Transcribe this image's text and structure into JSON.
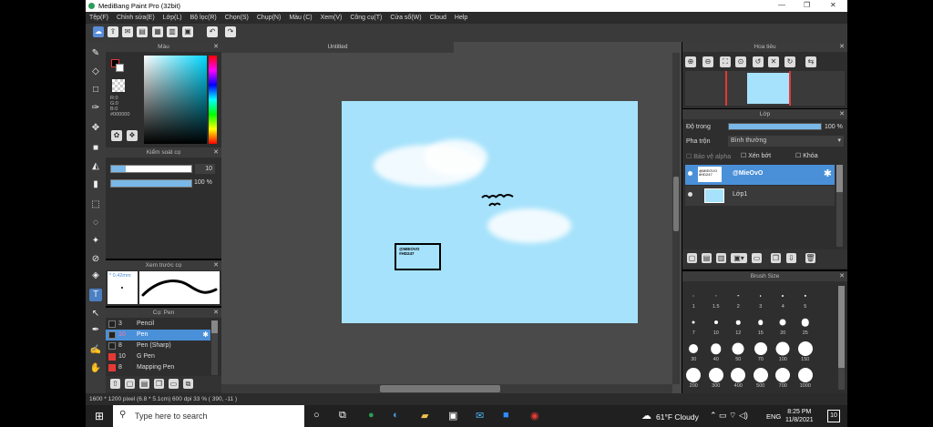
{
  "window": {
    "title": "MediBang Paint Pro (32bit)"
  },
  "menu": [
    "Tệp(F)",
    "Chỉnh sửa(E)",
    "Lớp(L)",
    "Bộ lọc(R)",
    "Chọn(S)",
    "Chụp(N)",
    "Màu (C)",
    "Xem(V)",
    "Công cụ(T)",
    "Cửa sổ(W)",
    "Cloud",
    "Help"
  ],
  "panels": {
    "color": {
      "title": "Màu",
      "r": "R:0",
      "g": "G:0",
      "b": "B:0",
      "hex": "#000000"
    },
    "brush_control": {
      "title": "Kiểm soát cọ",
      "size": "10",
      "opacity": "100 %"
    },
    "brush_preview": {
      "title": "Xem trước cọ",
      "size": "0.42mm"
    },
    "brush_list": {
      "title": "Cọ: Pen",
      "items": [
        {
          "size": "3",
          "name": "Pencil",
          "color": "#222222"
        },
        {
          "size": "10",
          "name": "Pen",
          "color": "#222222",
          "selected": true
        },
        {
          "size": "8",
          "name": "Pen (Sharp)",
          "color": "#222222"
        },
        {
          "size": "10",
          "name": "G Pen",
          "color": "#e53935"
        },
        {
          "size": "8",
          "name": "Mapping Pen",
          "color": "#e53935"
        }
      ]
    },
    "navigator": {
      "title": "Hoa tiêu"
    },
    "layer": {
      "title": "Lớp",
      "opacity_label": "Độ trong",
      "opacity_value": "100 %",
      "blend_label": "Pha trộn",
      "blend_value": "Bình thường",
      "protect_alpha": "Bảo vệ alpha",
      "clipping": "Xén bớt",
      "lock": "Khóa",
      "layers": [
        "@MieOvO",
        "Lớp1"
      ]
    },
    "brush_size": {
      "title": "Brush Size",
      "sizes": [
        "1",
        "1.5",
        "2",
        "3",
        "4",
        "5",
        "7",
        "10",
        "12",
        "15",
        "20",
        "25",
        "30",
        "40",
        "50",
        "70",
        "100",
        "150",
        "200",
        "300",
        "400",
        "500",
        "700",
        "1000"
      ]
    }
  },
  "canvas": {
    "tab": "Untitled",
    "sign_text": "@MIEOVO\n#HD247"
  },
  "status": {
    "text": "1600 * 1200 pixel  (6.8 * 5.1cm)  600 dpi  33 %  ( 390, -11 )"
  },
  "taskbar": {
    "search_placeholder": "Type here to search",
    "weather": "61°F  Cloudy",
    "lang": "ENG",
    "time": "8:25 PM",
    "date": "11/8/2021",
    "notif": "10"
  }
}
